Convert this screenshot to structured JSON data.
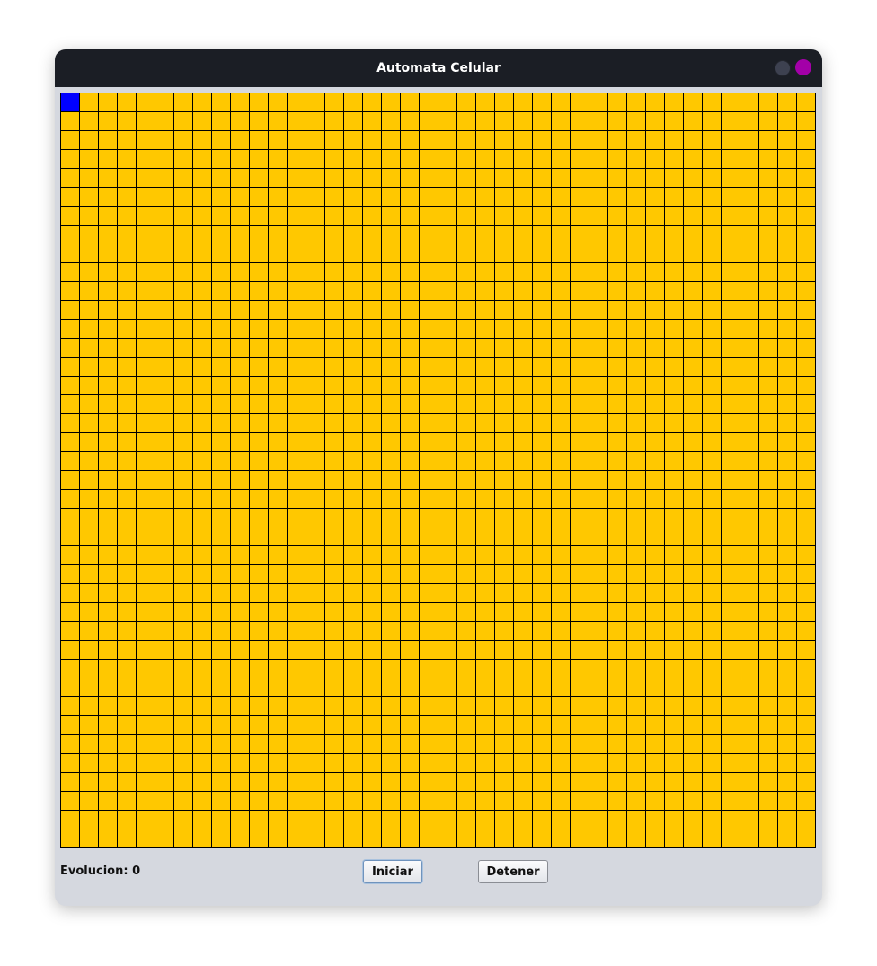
{
  "window": {
    "title": "Automata Celular"
  },
  "grid": {
    "rows": 40,
    "cols": 40,
    "dead_color": "#ffc800",
    "alive_color": "#0000ff",
    "alive_cells": [
      [
        0,
        0
      ]
    ]
  },
  "footer": {
    "status": "Evolucion: 0",
    "start_label": "Iniciar",
    "stop_label": "Detener"
  }
}
